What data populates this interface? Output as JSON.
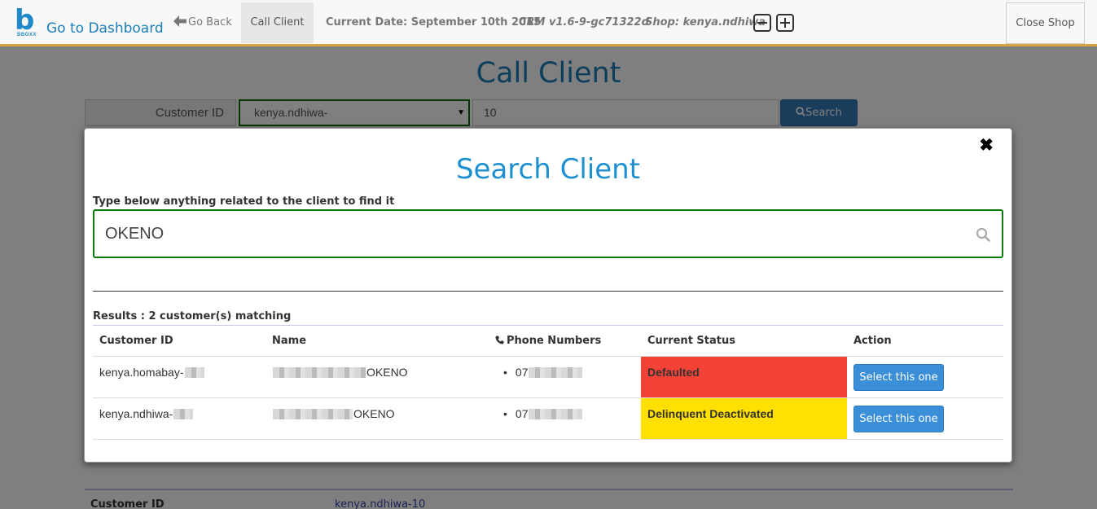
{
  "navbar": {
    "brand_logo_text": "BBOXX",
    "brand_link": "Go to Dashboard",
    "back": "Go Back",
    "call_client": "Call Client",
    "date": "Current Date: September 10th 2015",
    "version": "CRM v1.6-9-gc71322d",
    "shop": "Shop: kenya.ndhiwa",
    "close_shop": "Close Shop"
  },
  "page": {
    "title": "Call Client",
    "customer_id_label": "Customer ID",
    "prefix_select": "kenya.ndhiwa-",
    "number_value": "10",
    "search_label": "Search",
    "details": {
      "label": "Customer ID",
      "value": "kenya.ndhiwa-10"
    }
  },
  "modal": {
    "title": "Search Client",
    "instruction": "Type below anything related to the client to find it",
    "query": "OKENO",
    "results_label": "Results : 2 customer(s) matching",
    "columns": [
      "Customer ID",
      "Name",
      "Phone Numbers",
      "Current Status",
      "Action"
    ],
    "rows": [
      {
        "customer_id": "kenya.homabay-",
        "name": "OKENO",
        "phone": "07",
        "status": "Defaulted",
        "status_color": "#f44336",
        "action": "Select this one"
      },
      {
        "customer_id": "kenya.ndhiwa-",
        "name": "OKENO",
        "phone": "07",
        "status": "Delinquent Deactivated",
        "status_color": "#ffe000",
        "action": "Select this one"
      }
    ]
  },
  "colors": {
    "brand": "#1a7fb8",
    "accent_border": "#d9a63c",
    "primary_button": "#337ab7",
    "focus_green": "#0a7a0a"
  },
  "icons": {
    "back": "arrow-left-icon",
    "search": "search-icon",
    "phone": "phone-icon",
    "close": "close-icon",
    "zoom_out": "minus-square-icon",
    "zoom_in": "plus-square-icon"
  }
}
